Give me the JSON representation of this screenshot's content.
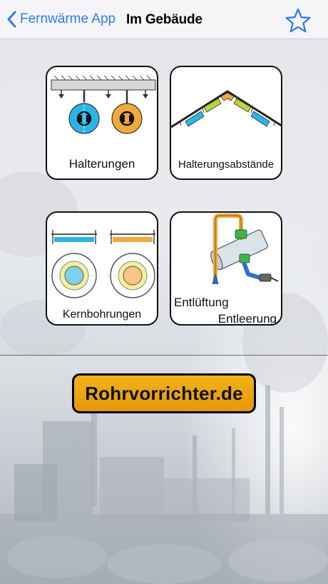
{
  "navbar": {
    "back_label": "Fernwärme App",
    "title": "Im Gebäude"
  },
  "tiles": [
    {
      "label": "Halterungen"
    },
    {
      "label": "Halterungsabstände"
    },
    {
      "label": "Kernbohrungen"
    },
    {
      "label_line1": "Entlüftung",
      "label_line2": "Entleerung"
    }
  ],
  "website_button": {
    "label": "Rohrvorrichter.de"
  },
  "colors": {
    "accent": "#2f7cf6",
    "pipe_blue": "#2bb5e6",
    "pipe_orange": "#f0a93b",
    "button_orange": "#f0ab17"
  }
}
